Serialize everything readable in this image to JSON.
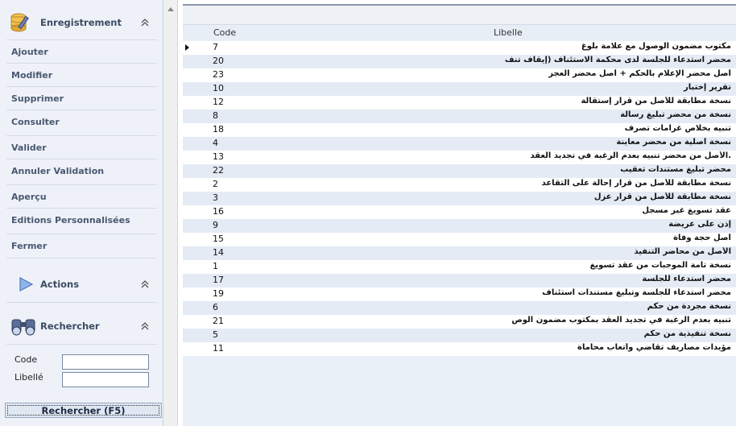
{
  "sidebar": {
    "enregistrement": {
      "title": "Enregistrement",
      "icon": "database-pencil-icon",
      "items": [
        {
          "label": "Ajouter"
        },
        {
          "label": "Modifier"
        },
        {
          "label": "Supprimer"
        },
        {
          "label": "Consulter"
        },
        {
          "label": "Valider"
        },
        {
          "label": "Annuler Validation"
        },
        {
          "label": "Aperçu"
        },
        {
          "label": "Editions Personnalisées"
        },
        {
          "label": "Fermer"
        }
      ]
    },
    "actions": {
      "title": "Actions",
      "icon": "play-arrow-icon"
    },
    "rechercher": {
      "title": "Rechercher",
      "icon": "binoculars-icon",
      "code_label": "Code",
      "code_value": "",
      "libelle_label": "Libellé",
      "libelle_value": "",
      "button_label": "Rechercher (F5)"
    }
  },
  "grid": {
    "columns": {
      "code": "Code",
      "libelle": "Libelle"
    },
    "current_row_index": 0,
    "rows": [
      {
        "code": "7",
        "libelle": "مكتوب مضمون الوصول مع علامة بلوغ"
      },
      {
        "code": "20",
        "libelle": "محضر استدعاء للجلسة لدى محكمة الاستئناف (إيقاف تنف"
      },
      {
        "code": "23",
        "libelle": "أصل محضر الإعلام بالحكم + أصل محضر العجز"
      },
      {
        "code": "10",
        "libelle": "تقرير إختبار"
      },
      {
        "code": "12",
        "libelle": "نسخة مطابقة للأصل من قرار إستقالة"
      },
      {
        "code": "8",
        "libelle": "نسخة من محضر تبليغ رسالة"
      },
      {
        "code": "18",
        "libelle": "تنبيه بخلاص غرامات تصرف"
      },
      {
        "code": "4",
        "libelle": "نسخة أصلية من محضر معاينة"
      },
      {
        "code": "13",
        "libelle": ".الأصل من محضر تنبيه بعدم الرغبة في تجديد العقد"
      },
      {
        "code": "22",
        "libelle": "محضر تبليغ مستندات تعقيب"
      },
      {
        "code": "2",
        "libelle": "نسخة مطابقة للأصل من قرار إحالة على التقاعد"
      },
      {
        "code": "3",
        "libelle": "نسخة مطابقة للأصل من قرار عزل"
      },
      {
        "code": "16",
        "libelle": "عقد تسويغ غير مسجل"
      },
      {
        "code": "9",
        "libelle": "إذن على عريضة"
      },
      {
        "code": "15",
        "libelle": "أصل حجة وفاة"
      },
      {
        "code": "14",
        "libelle": "الأصل من محاضر التنفيذ"
      },
      {
        "code": "1",
        "libelle": "نسخة تامة الموجبات من عقد تسويغ"
      },
      {
        "code": "17",
        "libelle": "محضر استدعاء للجلسة"
      },
      {
        "code": "19",
        "libelle": "محضر استدعاء للجلسة وتبليغ مستندات استئناف"
      },
      {
        "code": "6",
        "libelle": "نسخة مجردة من حكم"
      },
      {
        "code": "21",
        "libelle": "تنبيه بعدم الرغبة في تجديد العقد بمكتوب مضمون الوص"
      },
      {
        "code": "5",
        "libelle": "نسخة تنفيذية من حكم"
      },
      {
        "code": "11",
        "libelle": "مؤيدات مصاريف تقاضي وأتعاب محاماة"
      }
    ]
  },
  "colors": {
    "accent": "#3c4a63",
    "row_alt": "#e4ebf5",
    "sidebar_bg": "#eef2f8"
  }
}
